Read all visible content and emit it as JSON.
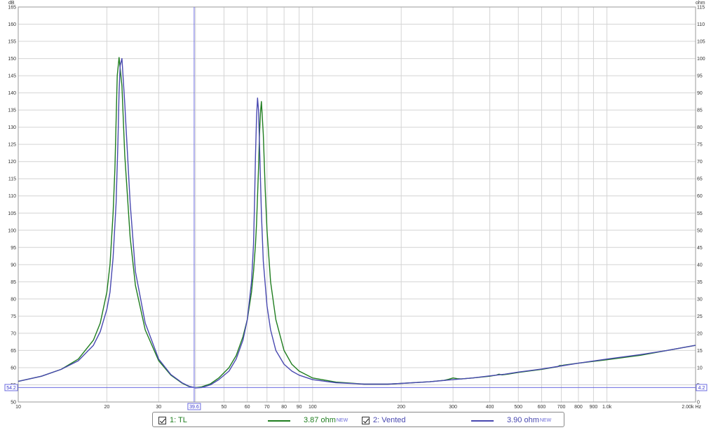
{
  "chart_data": {
    "type": "line",
    "xscale": "log",
    "xlim": [
      10,
      2000
    ],
    "y_left": {
      "unit": "dB",
      "lim": [
        50,
        165
      ],
      "ticks": [
        50,
        55,
        60,
        65,
        70,
        75,
        80,
        85,
        90,
        95,
        100,
        105,
        110,
        115,
        120,
        125,
        130,
        135,
        140,
        145,
        150,
        155,
        160,
        165
      ]
    },
    "y_right": {
      "unit": "ohm",
      "lim": [
        0,
        115
      ],
      "ticks": [
        0,
        5,
        10,
        15,
        20,
        25,
        30,
        35,
        40,
        45,
        50,
        55,
        60,
        65,
        70,
        75,
        80,
        85,
        90,
        95,
        100,
        105,
        110,
        115
      ]
    },
    "x_ticks": [
      {
        "v": 10,
        "l": "10"
      },
      {
        "v": 20,
        "l": "20"
      },
      {
        "v": 30,
        "l": "30"
      },
      {
        "v": 39.6,
        "l": "39.6",
        "cursor": true
      },
      {
        "v": 50,
        "l": "50"
      },
      {
        "v": 60,
        "l": "60"
      },
      {
        "v": 70,
        "l": "70"
      },
      {
        "v": 80,
        "l": "80"
      },
      {
        "v": 90,
        "l": "90"
      },
      {
        "v": 100,
        "l": "100"
      },
      {
        "v": 200,
        "l": "200"
      },
      {
        "v": 300,
        "l": "300"
      },
      {
        "v": 400,
        "l": "400"
      },
      {
        "v": 500,
        "l": "500"
      },
      {
        "v": 600,
        "l": "600"
      },
      {
        "v": 700,
        "l": "700"
      },
      {
        "v": 800,
        "l": "800"
      },
      {
        "v": 900,
        "l": "900"
      },
      {
        "v": 1000,
        "l": "1.0k"
      },
      {
        "v": 2000,
        "l": "2.00k Hz"
      }
    ],
    "x_gridlines": [
      10,
      20,
      30,
      40,
      50,
      60,
      70,
      80,
      90,
      100,
      200,
      300,
      400,
      500,
      600,
      700,
      800,
      900,
      1000,
      2000
    ],
    "grid": true,
    "cursor": {
      "x": 39.6,
      "x_label": "39.6",
      "y_left_label": "54.2",
      "y_right_label": "4.2",
      "y_left": 54.2
    },
    "series": [
      {
        "name": "1: TL",
        "legend_value": "3.87 ohm",
        "legend_tag": "NEW",
        "color": "#1f7d1f",
        "x": [
          10,
          12,
          14,
          16,
          18,
          19,
          20,
          20.5,
          21,
          21.3,
          21.5,
          21.7,
          22,
          22.5,
          23,
          24,
          25,
          27,
          30,
          33,
          36,
          38,
          40,
          42,
          45,
          48,
          52,
          55,
          58,
          60,
          62,
          63,
          64,
          64.5,
          65,
          65.5,
          66,
          66.5,
          67,
          68,
          69,
          70,
          72,
          75,
          80,
          85,
          90,
          100,
          120,
          150,
          180,
          200,
          250,
          280,
          290,
          300,
          310,
          320,
          350,
          400,
          420,
          430,
          440,
          460,
          500,
          600,
          680,
          690,
          700,
          710,
          800,
          1000,
          1300,
          1600,
          2000
        ],
        "y": [
          56,
          57.5,
          59.5,
          62.5,
          68,
          73,
          82,
          90,
          105,
          118,
          132,
          145,
          150.3,
          142,
          122,
          98,
          84,
          71,
          62,
          57.8,
          55.5,
          54.5,
          54.2,
          54.4,
          55.3,
          57,
          60,
          63.5,
          69,
          74,
          82,
          88,
          96,
          102,
          110,
          118,
          128,
          134,
          137.5,
          128,
          112,
          100,
          85,
          74,
          65,
          61,
          59,
          57,
          55.8,
          55.2,
          55.2,
          55.4,
          55.9,
          56.3,
          56.6,
          57,
          56.8,
          56.7,
          57,
          57.5,
          57.8,
          58.1,
          57.9,
          58.1,
          58.6,
          59.5,
          60.3,
          60.6,
          60.6,
          60.7,
          61.3,
          62.3,
          63.6,
          65,
          66.5
        ]
      },
      {
        "name": "2: Vented",
        "legend_value": "3.90 ohm",
        "legend_tag": "NEW",
        "color": "#4848b0",
        "x": [
          10,
          12,
          14,
          16,
          18,
          19,
          20,
          20.5,
          21,
          21.5,
          21.8,
          22,
          22.2,
          22.5,
          23,
          24,
          25,
          27,
          30,
          33,
          36,
          38,
          40,
          42,
          45,
          48,
          52,
          55,
          58,
          60,
          62,
          63,
          63.5,
          64,
          64.5,
          65,
          65.5,
          66,
          67,
          68,
          70,
          72,
          75,
          80,
          85,
          90,
          100,
          120,
          150,
          180,
          200,
          250,
          300,
          350,
          400,
          450,
          500,
          600,
          700,
          800,
          1000,
          1300,
          1600,
          2000
        ],
        "y": [
          56,
          57.5,
          59.5,
          62,
          66.5,
          70.5,
          77,
          82,
          92,
          108,
          125,
          140,
          148,
          150,
          137,
          108,
          88,
          73,
          62.5,
          58,
          55.6,
          54.6,
          54.1,
          54.2,
          55,
          56.5,
          59,
          62.5,
          68,
          74,
          85,
          96,
          108,
          122,
          133,
          138.5,
          135,
          125,
          105,
          91,
          78,
          71,
          65,
          61,
          59,
          57.8,
          56.5,
          55.6,
          55.2,
          55.2,
          55.4,
          55.9,
          56.5,
          57,
          57.6,
          58.1,
          58.7,
          59.6,
          60.5,
          61.3,
          62.5,
          63.8,
          65,
          66.5
        ]
      }
    ]
  }
}
